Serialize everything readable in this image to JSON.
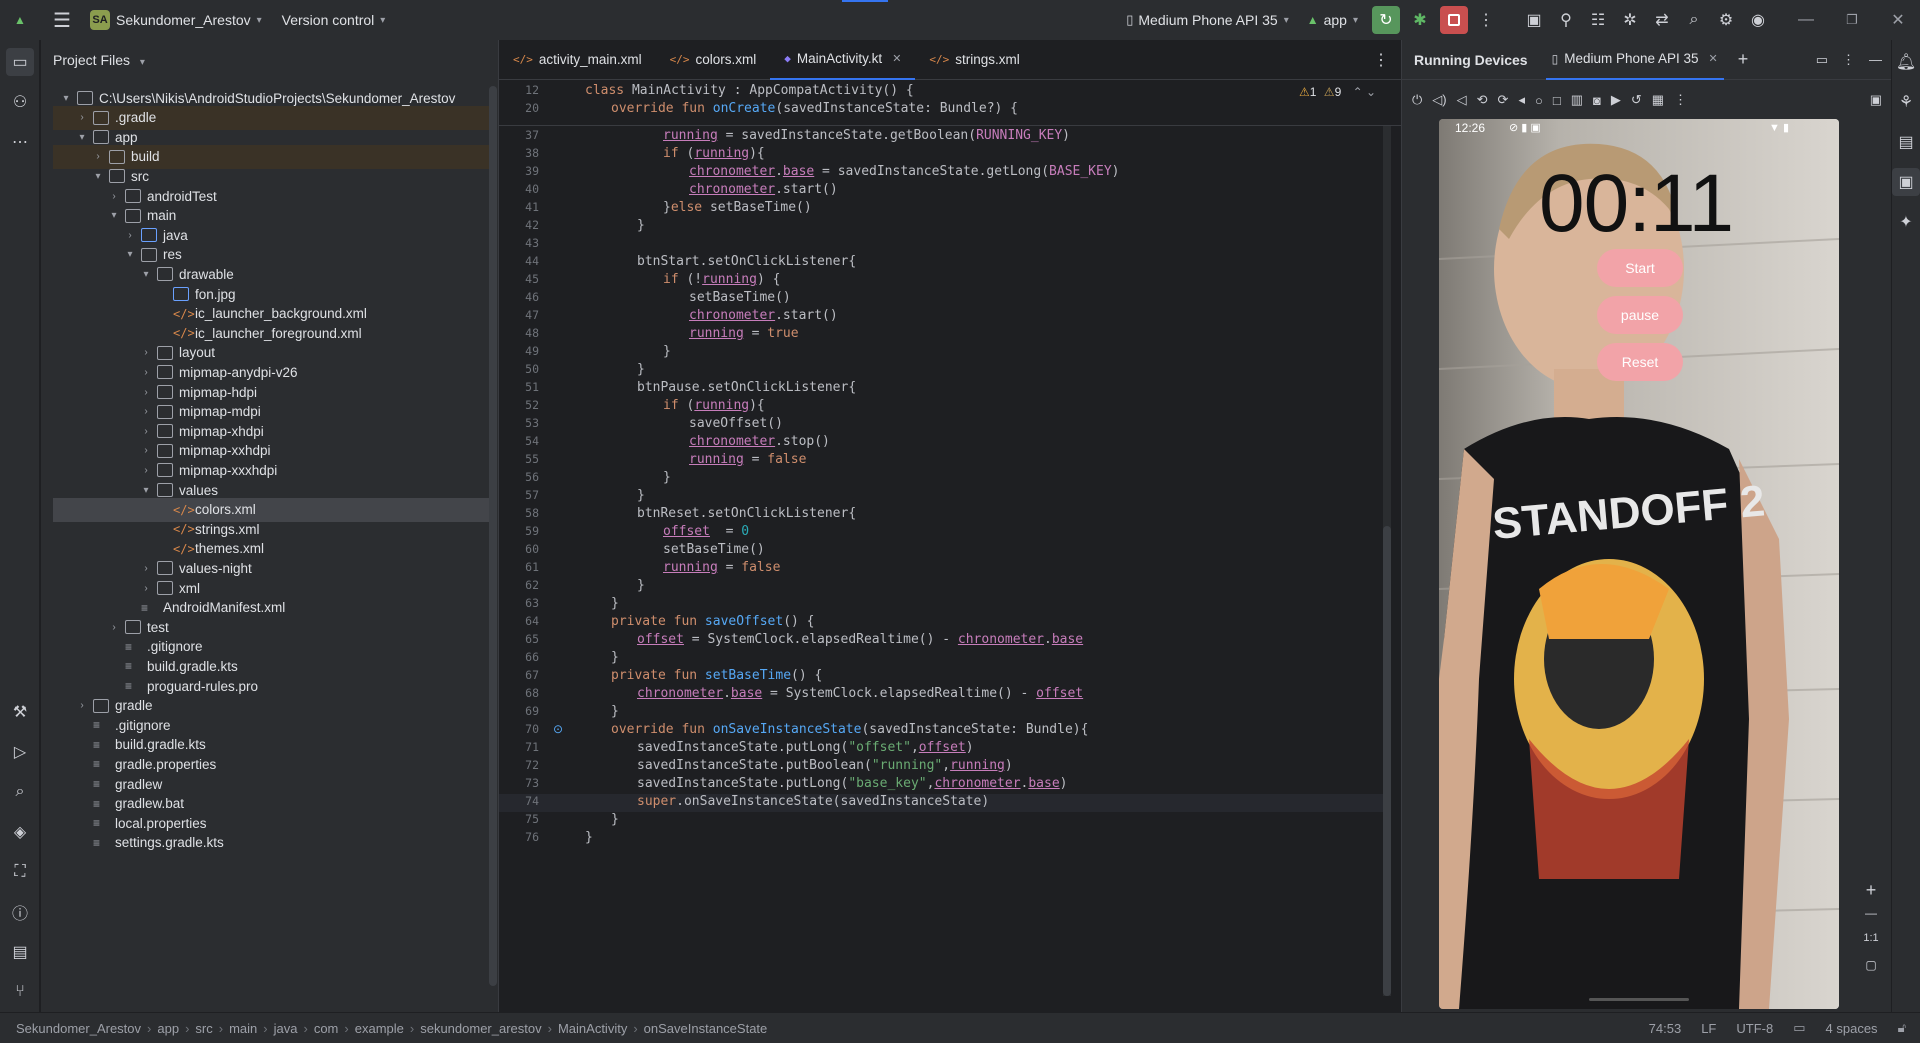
{
  "titlebar": {
    "project_badge": "SA",
    "project_name": "Sekundomer_Arestov",
    "vcs": "Version control",
    "device": "Medium Phone API 35",
    "run_config": "app"
  },
  "project_panel": {
    "title": "Project Files",
    "items": [
      {
        "label": "C:\\Users\\Nikis\\AndroidStudioProjects\\Sekundomer_Arestov",
        "depth": 0,
        "arrow": "v",
        "kind": "folder"
      },
      {
        "label": ".gradle",
        "depth": 1,
        "arrow": ">",
        "kind": "folder",
        "hl": true
      },
      {
        "label": "app",
        "depth": 1,
        "arrow": "v",
        "kind": "folder"
      },
      {
        "label": "build",
        "depth": 2,
        "arrow": ">",
        "kind": "folder",
        "hl": true
      },
      {
        "label": "src",
        "depth": 2,
        "arrow": "v",
        "kind": "folder"
      },
      {
        "label": "androidTest",
        "depth": 3,
        "arrow": ">",
        "kind": "folder"
      },
      {
        "label": "main",
        "depth": 3,
        "arrow": "v",
        "kind": "folder"
      },
      {
        "label": "java",
        "depth": 4,
        "arrow": ">",
        "kind": "mod"
      },
      {
        "label": "res",
        "depth": 4,
        "arrow": "v",
        "kind": "folder"
      },
      {
        "label": "drawable",
        "depth": 5,
        "arrow": "v",
        "kind": "folder"
      },
      {
        "label": "fon.jpg",
        "depth": 6,
        "arrow": "",
        "kind": "img"
      },
      {
        "label": "ic_launcher_background.xml",
        "depth": 6,
        "arrow": "",
        "kind": "file"
      },
      {
        "label": "ic_launcher_foreground.xml",
        "depth": 6,
        "arrow": "",
        "kind": "file"
      },
      {
        "label": "layout",
        "depth": 5,
        "arrow": ">",
        "kind": "folder"
      },
      {
        "label": "mipmap-anydpi-v26",
        "depth": 5,
        "arrow": ">",
        "kind": "folder"
      },
      {
        "label": "mipmap-hdpi",
        "depth": 5,
        "arrow": ">",
        "kind": "folder"
      },
      {
        "label": "mipmap-mdpi",
        "depth": 5,
        "arrow": ">",
        "kind": "folder"
      },
      {
        "label": "mipmap-xhdpi",
        "depth": 5,
        "arrow": ">",
        "kind": "folder"
      },
      {
        "label": "mipmap-xxhdpi",
        "depth": 5,
        "arrow": ">",
        "kind": "folder"
      },
      {
        "label": "mipmap-xxxhdpi",
        "depth": 5,
        "arrow": ">",
        "kind": "folder"
      },
      {
        "label": "values",
        "depth": 5,
        "arrow": "v",
        "kind": "folder"
      },
      {
        "label": "colors.xml",
        "depth": 6,
        "arrow": "",
        "kind": "file",
        "sel": true
      },
      {
        "label": "strings.xml",
        "depth": 6,
        "arrow": "",
        "kind": "file"
      },
      {
        "label": "themes.xml",
        "depth": 6,
        "arrow": "",
        "kind": "file"
      },
      {
        "label": "values-night",
        "depth": 5,
        "arrow": ">",
        "kind": "folder"
      },
      {
        "label": "xml",
        "depth": 5,
        "arrow": ">",
        "kind": "folder"
      },
      {
        "label": "AndroidManifest.xml",
        "depth": 4,
        "arrow": "",
        "kind": "txt"
      },
      {
        "label": "test",
        "depth": 3,
        "arrow": ">",
        "kind": "folder"
      },
      {
        "label": ".gitignore",
        "depth": 3,
        "arrow": "",
        "kind": "txt"
      },
      {
        "label": "build.gradle.kts",
        "depth": 3,
        "arrow": "",
        "kind": "txt"
      },
      {
        "label": "proguard-rules.pro",
        "depth": 3,
        "arrow": "",
        "kind": "txt"
      },
      {
        "label": "gradle",
        "depth": 1,
        "arrow": ">",
        "kind": "folder"
      },
      {
        "label": ".gitignore",
        "depth": 1,
        "arrow": "",
        "kind": "txt"
      },
      {
        "label": "build.gradle.kts",
        "depth": 1,
        "arrow": "",
        "kind": "txt"
      },
      {
        "label": "gradle.properties",
        "depth": 1,
        "arrow": "",
        "kind": "txt"
      },
      {
        "label": "gradlew",
        "depth": 1,
        "arrow": "",
        "kind": "txt"
      },
      {
        "label": "gradlew.bat",
        "depth": 1,
        "arrow": "",
        "kind": "txt"
      },
      {
        "label": "local.properties",
        "depth": 1,
        "arrow": "",
        "kind": "txt"
      },
      {
        "label": "settings.gradle.kts",
        "depth": 1,
        "arrow": "",
        "kind": "txt"
      }
    ]
  },
  "editor": {
    "tabs": [
      {
        "label": "activity_main.xml",
        "active": false
      },
      {
        "label": "colors.xml",
        "active": false
      },
      {
        "label": "MainActivity.kt",
        "active": true
      },
      {
        "label": "strings.xml",
        "active": false
      }
    ],
    "inspections": {
      "warnings": "1",
      "weak_warnings": "9"
    },
    "sticky": [
      {
        "n": "12",
        "html": "<span class='kw'>class</span> MainActivity : AppCompatActivity() {",
        "indent": 0
      },
      {
        "n": "20",
        "html": "<span class='kw'>override fun</span> <span class='fn'>onCreate</span>(savedInstanceState: Bundle?) {",
        "indent": 1
      }
    ],
    "lines": [
      {
        "n": "37",
        "indent": 3,
        "html": "<span class='prop und'>running</span> = savedInstanceState.getBoolean(<span class='prop'>RUNNING_KEY</span>)"
      },
      {
        "n": "38",
        "indent": 3,
        "html": "<span class='kw'>if</span> (<span class='prop und'>running</span>){"
      },
      {
        "n": "39",
        "indent": 4,
        "html": "<span class='prop und'>chronometer</span>.<span class='prop und'>base</span> = savedInstanceState.getLong(<span class='prop'>BASE_KEY</span>)"
      },
      {
        "n": "40",
        "indent": 4,
        "html": "<span class='prop und'>chronometer</span>.start()"
      },
      {
        "n": "41",
        "indent": 3,
        "html": "}<span class='kw'>else</span> setBaseTime()"
      },
      {
        "n": "42",
        "indent": 2,
        "html": "}"
      },
      {
        "n": "43",
        "indent": 0,
        "html": ""
      },
      {
        "n": "44",
        "indent": 2,
        "html": "btnStart.setOnClickListener{"
      },
      {
        "n": "45",
        "indent": 3,
        "html": "<span class='kw'>if</span> (!<span class='prop und'>running</span>) {"
      },
      {
        "n": "46",
        "indent": 4,
        "html": "setBaseTime()"
      },
      {
        "n": "47",
        "indent": 4,
        "html": "<span class='prop und'>chronometer</span>.start()"
      },
      {
        "n": "48",
        "indent": 4,
        "html": "<span class='prop und'>running</span> = <span class='kw'>true</span>"
      },
      {
        "n": "49",
        "indent": 3,
        "html": "}"
      },
      {
        "n": "50",
        "indent": 2,
        "html": "}"
      },
      {
        "n": "51",
        "indent": 2,
        "html": "btnPause.setOnClickListener{"
      },
      {
        "n": "52",
        "indent": 3,
        "html": "<span class='kw'>if</span> (<span class='prop und'>running</span>){"
      },
      {
        "n": "53",
        "indent": 4,
        "html": "saveOffset()"
      },
      {
        "n": "54",
        "indent": 4,
        "html": "<span class='prop und'>chronometer</span>.stop()"
      },
      {
        "n": "55",
        "indent": 4,
        "html": "<span class='prop und'>running</span> = <span class='kw'>false</span>"
      },
      {
        "n": "56",
        "indent": 3,
        "html": "}"
      },
      {
        "n": "57",
        "indent": 2,
        "html": "}"
      },
      {
        "n": "58",
        "indent": 2,
        "html": "btnReset.setOnClickListener{"
      },
      {
        "n": "59",
        "indent": 3,
        "html": "<span class='prop und'>offset</span>  = <span class='num'>0</span>"
      },
      {
        "n": "60",
        "indent": 3,
        "html": "setBaseTime()"
      },
      {
        "n": "61",
        "indent": 3,
        "html": "<span class='prop und'>running</span> = <span class='kw'>false</span>"
      },
      {
        "n": "62",
        "indent": 2,
        "html": "}"
      },
      {
        "n": "63",
        "indent": 1,
        "html": "}"
      },
      {
        "n": "64",
        "indent": 1,
        "html": "<span class='kw'>private fun</span> <span class='fn'>saveOffset</span>() {"
      },
      {
        "n": "65",
        "indent": 2,
        "html": "<span class='prop und'>offset</span> = SystemClock.elapsedRealtime() - <span class='prop und'>chronometer</span>.<span class='prop und'>base</span>"
      },
      {
        "n": "66",
        "indent": 1,
        "html": "}"
      },
      {
        "n": "67",
        "indent": 1,
        "html": "<span class='kw'>private fun</span> <span class='fn'>setBaseTime</span>() {"
      },
      {
        "n": "68",
        "indent": 2,
        "html": "<span class='prop und'>chronometer</span>.<span class='prop und'>base</span> = SystemClock.elapsedRealtime() - <span class='prop und'>offset</span>"
      },
      {
        "n": "69",
        "indent": 1,
        "html": "}"
      },
      {
        "n": "70",
        "indent": 1,
        "html": "<span class='kw'>override fun</span> <span class='fn'>onSaveInstanceState</span>(savedInstanceState: Bundle){"
      },
      {
        "n": "71",
        "indent": 2,
        "html": "savedInstanceState.putLong(<span class='str'>\"offset\"</span>,<span class='prop und'>offset</span>)"
      },
      {
        "n": "72",
        "indent": 2,
        "html": "savedInstanceState.putBoolean(<span class='str'>\"running\"</span>,<span class='prop und'>running</span>)"
      },
      {
        "n": "73",
        "indent": 2,
        "html": "savedInstanceState.putLong(<span class='str'>\"base_key\"</span>,<span class='prop und'>chronometer</span>.<span class='prop und'>base</span>)"
      },
      {
        "n": "74",
        "indent": 2,
        "html": "<span class='kw'>super</span>.onSaveInstanceState(savedInstanceState)"
      },
      {
        "n": "75",
        "indent": 1,
        "html": "}"
      },
      {
        "n": "76",
        "indent": 0,
        "html": "}"
      }
    ]
  },
  "devices": {
    "title": "Running Devices",
    "device_tab": "Medium Phone API 35",
    "phone": {
      "time": "12:26",
      "chronometer": "00:11",
      "buttons": [
        "Start",
        "pause",
        "Reset"
      ],
      "shirt_text": "STANDOFF 2"
    },
    "zoom_label": "1:1"
  },
  "statusbar": {
    "breadcrumbs": [
      "Sekundomer_Arestov",
      "app",
      "src",
      "main",
      "java",
      "com",
      "example",
      "sekundomer_arestov",
      "MainActivity",
      "onSaveInstanceState"
    ],
    "position": "74:53",
    "line_sep": "LF",
    "encoding": "UTF-8",
    "indent": "4 spaces"
  }
}
